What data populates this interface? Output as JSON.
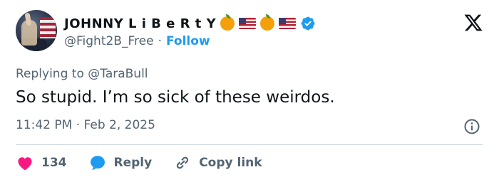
{
  "tweet": {
    "author": {
      "display_name": "JOHNNY L i B e R t Y",
      "name_emojis": [
        "orange",
        "us-flag",
        "orange",
        "us-flag"
      ],
      "verified": true,
      "handle": "@Fight2B_Free",
      "separator": "·",
      "follow_label": "Follow"
    },
    "replying_prefix": "Replying to",
    "replying_to": "@TaraBull",
    "text": "So stupid. I’m so sick of these weirdos.",
    "timestamp": "11:42 PM · Feb 2, 2025",
    "actions": {
      "likes_count": "134",
      "reply_label": "Reply",
      "copy_link_label": "Copy link"
    },
    "colors": {
      "accent": "#1d9bf0",
      "like": "#f91880",
      "muted_text": "#536471",
      "main_text": "#0f1419"
    }
  }
}
